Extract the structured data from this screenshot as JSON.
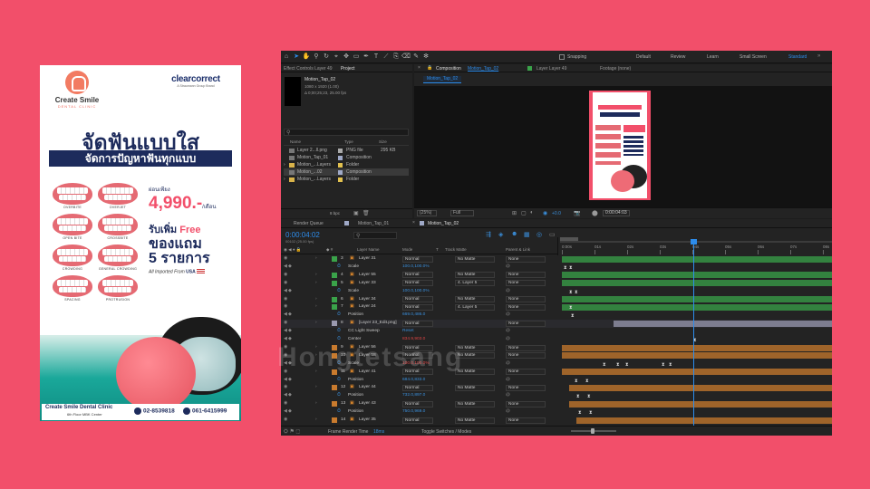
{
  "poster": {
    "logo_left_title": "Create Smile",
    "logo_left_sub": "DENTAL CLINIC",
    "logo_right_title": "clearcorrect",
    "logo_right_sub": "A Straumann Group Brand",
    "headline": "จัดฟันแบบใส",
    "subline": "จัดการปัญหาฟันทุกแบบ",
    "teeth": [
      {
        "label": "OVERBITE"
      },
      {
        "label": "OVERJET"
      },
      {
        "label": "OPEN BITE"
      },
      {
        "label": "CROSSBITE"
      },
      {
        "label": "CROWDING"
      },
      {
        "label": "GENERAL CROWDING"
      },
      {
        "label": "SPACING"
      },
      {
        "label": "PROTRUSION"
      }
    ],
    "price_prefix": "ผ่อนเพียง",
    "price": "4,990.-",
    "price_unit": "/เดือน",
    "gift_line1_pre": "รับเพิ่ม",
    "gift_line1_free": "Free",
    "gift_line2": "ของแถม",
    "gift_line3": "5 รายการ",
    "imported_pre": "All Imported From",
    "imported_country": "USA",
    "clinic_name": "Create Smile Dental Clinic",
    "clinic_floor": "6th Floor MBK Center",
    "phone1": "02-8539818",
    "phone2": "061-6415999"
  },
  "ae": {
    "toolbar": {
      "snapping": "Snapping",
      "workspaces": [
        "Default",
        "Review",
        "Learn",
        "Small Screen",
        "Standard"
      ],
      "active_workspace": "Standard"
    },
    "project_panel": {
      "tab_effect": "Effect Controls Layer 49",
      "tab_project": "Project",
      "item_name": "Motion_Tap_02",
      "item_size": "1080 x 1920 (1.00)",
      "item_dur": "Δ 0;00;25;23, 25.00 fps",
      "search_placeholder": "",
      "col_name": "Name",
      "col_type": "Type",
      "col_size": "Size",
      "rows": [
        {
          "name": "Layer 2...ll.png",
          "type": "PNG file",
          "size": "295 KB",
          "color": "#a9a9a9"
        },
        {
          "name": "Motion_Tap_01",
          "type": "Composition",
          "size": "",
          "color": "#9fa9c7"
        },
        {
          "name": "Motion_...Layers",
          "type": "Folder",
          "size": "",
          "color": "#e2c14f"
        },
        {
          "name": "Motion_...02",
          "type": "Composition",
          "size": "",
          "color": "#9fa9c7"
        },
        {
          "name": "Motion_...Layers",
          "type": "Folder",
          "size": "",
          "color": "#e2c14f"
        }
      ],
      "bpc": "8 bpc"
    },
    "comp_panel": {
      "tab_comp": "Composition",
      "tab_comp_name": "Motion_Tap_02",
      "tab_layer": "Layer Layer 49",
      "tab_footage": "Footage (none)",
      "breadcrumb": "Motion_Tap_02",
      "zoom": "(25%)",
      "resolution": "Full",
      "exposure": "+0.0",
      "timecode": "0:00:04:03"
    },
    "timeline": {
      "tabs": [
        "Render Queue",
        "Motion_Tap_01",
        "Motion_Tap_02"
      ],
      "active_tab": "Motion_Tap_02",
      "current_time": "0:00:04:02",
      "fps_info": "00102 (25.00 fps)",
      "col_layer_name": "Layer Name",
      "col_mode": "Mode",
      "col_trkmat": "Track Matte",
      "col_parent": "Parent & Link",
      "ruler": [
        "0:00s",
        "01s",
        "02s",
        "03s",
        "04s",
        "05s",
        "06s",
        "07s",
        "08s"
      ],
      "footer_render_label": "Frame Render Time",
      "footer_render_time": "18ms",
      "footer_toggle": "Toggle Switches / Modes",
      "rows": [
        {
          "num": "3",
          "name": "Layer 31",
          "mode": "Normal",
          "tm": "No Matte",
          "parent": "None",
          "color": "#3aa34a",
          "kind": "layer"
        },
        {
          "name": "Scale",
          "value": "100.0,100.0%",
          "kind": "prop"
        },
        {
          "num": "4",
          "name": "Layer 55",
          "mode": "Normal",
          "tm": "No Matte",
          "parent": "None",
          "color": "#3aa34a",
          "kind": "layer"
        },
        {
          "num": "5",
          "name": "Layer 33",
          "mode": "Normal",
          "tm": "4. Layer 5",
          "parent": "None",
          "color": "#3aa34a",
          "kind": "layer"
        },
        {
          "name": "Scale",
          "value": "100.0,100.0%",
          "kind": "prop"
        },
        {
          "num": "6",
          "name": "Layer 34",
          "mode": "Normal",
          "tm": "No Matte",
          "parent": "None",
          "color": "#3aa34a",
          "kind": "layer"
        },
        {
          "num": "7",
          "name": "Layer 24",
          "mode": "Normal",
          "tm": "4. Layer 5",
          "parent": "None",
          "color": "#3aa34a",
          "kind": "layer"
        },
        {
          "name": "Position",
          "value": "669.0,486.0",
          "kind": "prop"
        },
        {
          "num": "8",
          "name": "[Layer 23_Edit.png]",
          "mode": "Normal",
          "tm": "",
          "parent": "None",
          "color": "#9a9ab0",
          "kind": "layer"
        },
        {
          "name": "CC Light Sweep",
          "value": "Reset",
          "kind": "effect"
        },
        {
          "name": "Center",
          "value": "834.9,903.0",
          "kind": "prop",
          "red": true
        },
        {
          "num": "9",
          "name": "Layer 56",
          "mode": "Normal",
          "tm": "No Matte",
          "parent": "None",
          "color": "#c97b2e",
          "kind": "layer"
        },
        {
          "num": "10",
          "name": "Layer 58",
          "mode": "Normal",
          "tm": "No Matte",
          "parent": "None",
          "color": "#c97b2e",
          "kind": "layer"
        },
        {
          "name": "Scale",
          "value": "100.0,100.0%",
          "kind": "prop",
          "red": true
        },
        {
          "num": "11",
          "name": "Layer 41",
          "mode": "Normal",
          "tm": "No Matte",
          "parent": "None",
          "color": "#c97b2e",
          "kind": "layer"
        },
        {
          "name": "Position",
          "value": "684.0,833.0",
          "kind": "prop"
        },
        {
          "num": "12",
          "name": "Layer 44",
          "mode": "Normal",
          "tm": "No Matte",
          "parent": "None",
          "color": "#c97b2e",
          "kind": "layer"
        },
        {
          "name": "Position",
          "value": "732.0,897.0",
          "kind": "prop"
        },
        {
          "num": "13",
          "name": "Layer 43",
          "mode": "Normal",
          "tm": "No Matte",
          "parent": "None",
          "color": "#c97b2e",
          "kind": "layer"
        },
        {
          "name": "Position",
          "value": "750.0,969.0",
          "kind": "prop"
        },
        {
          "num": "14",
          "name": "Layer 35",
          "mode": "Normal",
          "tm": "No Matte",
          "parent": "None",
          "color": "#c97b2e",
          "kind": "layer"
        }
      ]
    }
  },
  "watermark": "Hongtetsang"
}
